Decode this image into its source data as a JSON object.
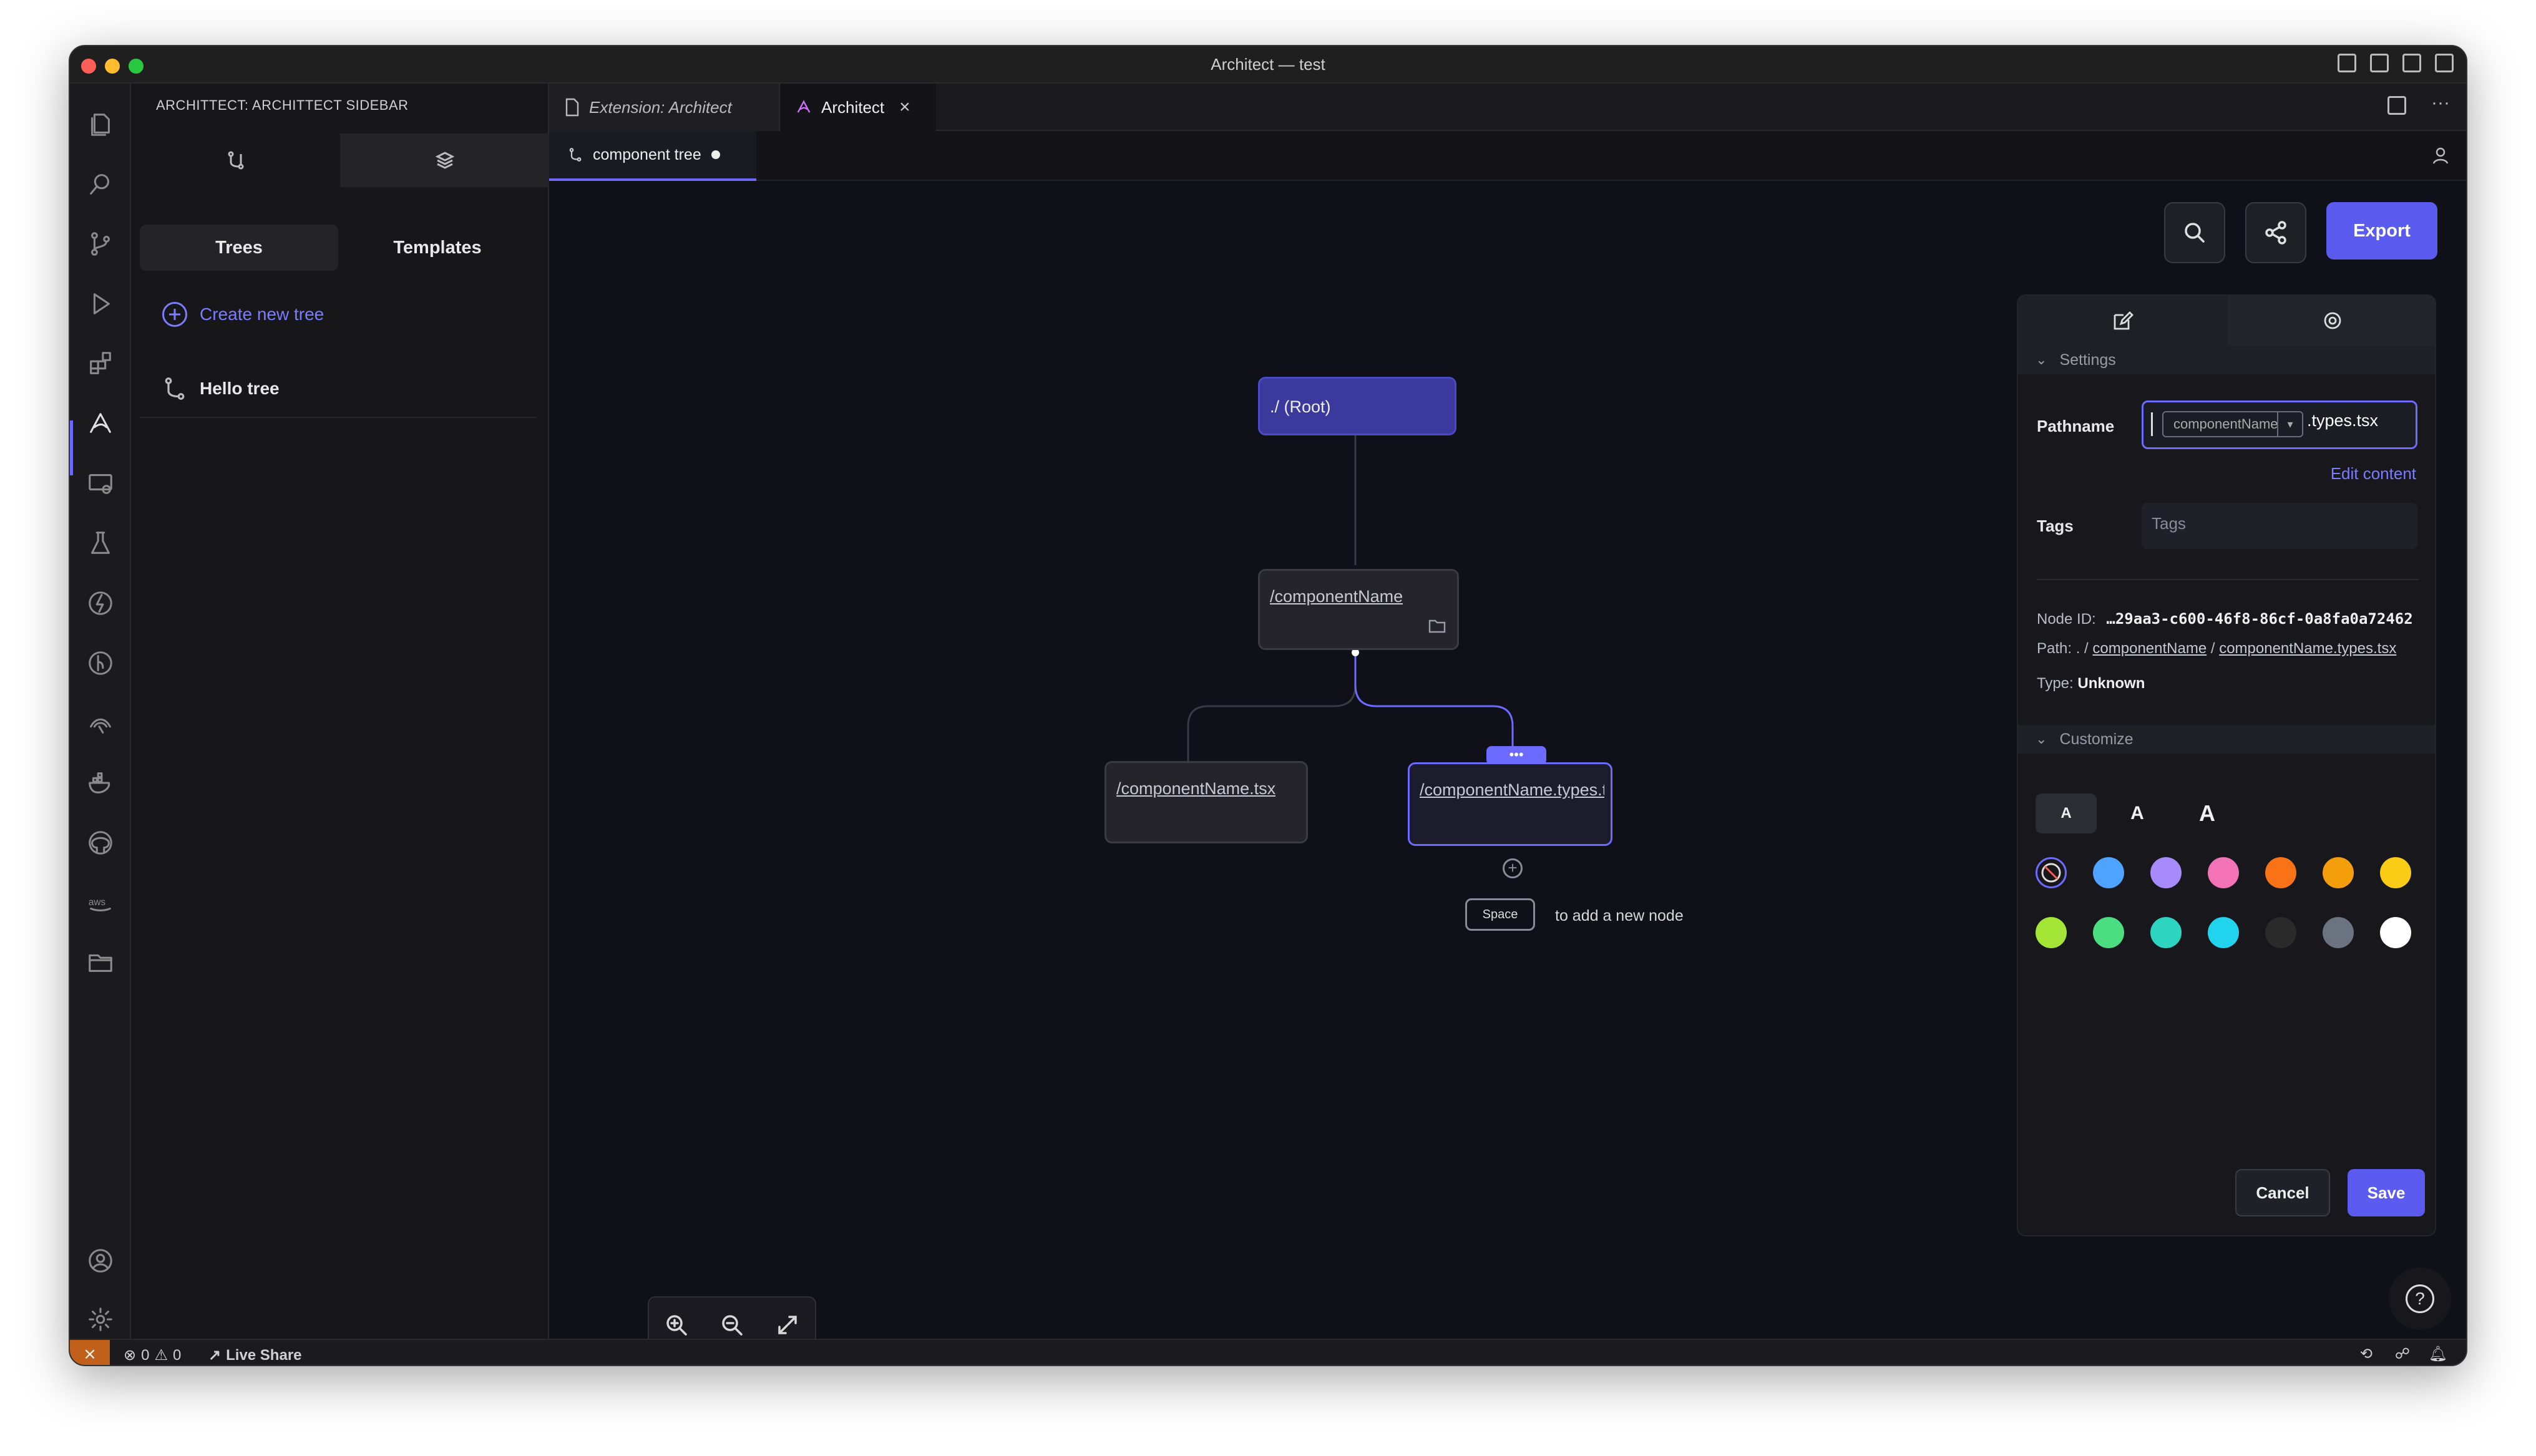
{
  "window": {
    "title": "Architect — test"
  },
  "sidebar": {
    "title": "ARCHITTECT: ARCHITTECT SIDEBAR",
    "segments": [
      "Trees",
      "Templates"
    ],
    "create_label": "Create new tree",
    "trees": [
      "Hello tree"
    ]
  },
  "editor_tabs": [
    {
      "label": "Extension: Architect"
    },
    {
      "label": "Architect"
    }
  ],
  "subtab": {
    "label": "component tree"
  },
  "toolbar": {
    "export_label": "Export"
  },
  "nodes": {
    "root": "./ (Root)",
    "folder": "/componentName",
    "child1": "/componentName.tsx",
    "child2": "/componentName.types.tsx",
    "menu_dots": "•••"
  },
  "hint": {
    "key": "Space",
    "text": "to add a new node"
  },
  "panel": {
    "settings_header": "Settings",
    "pathname_label": "Pathname",
    "pathname_var": "componentName",
    "pathname_suffix": ".types.tsx",
    "edit_content": "Edit content",
    "tags_label": "Tags",
    "tags_placeholder": "Tags",
    "node_id_label": "Node ID:",
    "node_id_value": "…29aa3-c600-46f8-86cf-0a8fa0a72462",
    "path_label": "Path:",
    "path_root": ". /",
    "path_folder": "componentName",
    "path_sep": "/",
    "path_file": "componentName.types.tsx",
    "type_label": "Type:",
    "type_value": "Unknown",
    "customize_header": "Customize",
    "font_sizes": [
      "A",
      "A",
      "A"
    ],
    "colors_row1": [
      "#ffffff00",
      "#4ea3ff",
      "#a78bfa",
      "#f472b6",
      "#f97316",
      "#f59e0b",
      "#facc15"
    ],
    "colors_row2": [
      "#a3e635",
      "#4ade80",
      "#2dd4bf",
      "#22d3ee",
      "#2a2a2a",
      "#6b7280",
      "#ffffff"
    ],
    "cancel_label": "Cancel",
    "save_label": "Save"
  },
  "statusbar": {
    "errors": "0",
    "warnings": "0",
    "live_share": "Live Share"
  }
}
